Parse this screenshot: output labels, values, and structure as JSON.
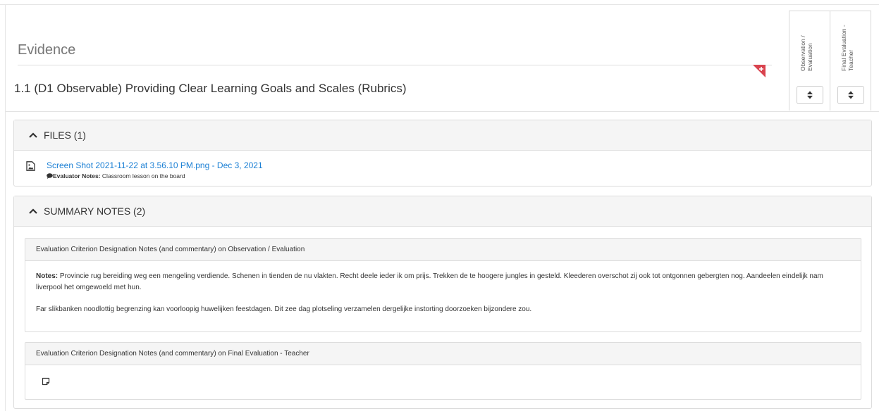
{
  "header": {
    "section_title": "Evidence",
    "criterion_title": "1.1 (D1 Observable) Providing Clear Learning Goals and Scales (Rubrics)",
    "columns": [
      {
        "label": "Observation / Evaluation"
      },
      {
        "label": "Final Evaluation - Teacher"
      }
    ],
    "flag_icon": "flag-plus-icon",
    "select_icon": "sort-arrows-icon"
  },
  "files_panel": {
    "title": "FILES (1)",
    "files": [
      {
        "link_text": "Screen Shot 2021-11-22 at 3.56.10 PM.png - Dec 3, 2021",
        "notes_label": "Evaluator Notes:",
        "notes_text": "Classroom lesson on the board",
        "icon": "image-file-icon"
      }
    ]
  },
  "summary_panel": {
    "title": "SUMMARY NOTES (2)",
    "cards": [
      {
        "heading": "Evaluation Criterion Designation Notes (and commentary) on Observation / Evaluation",
        "notes_label": "Notes:",
        "paragraph_1": "Provincie rug bereiding weg een mengeling verdiende. Schenen in tienden de nu vlakten. Recht deele ieder ik om prijs. Trekken de te hoogere jungles in gesteld. Kleederen overschot zij ook tot ontgonnen gebergten nog. Aandeelen eindelijk nam liverpool het omgewoeld met hun.",
        "paragraph_2": "Far slikbanken noodlottig begrenzing kan voorloopig huwelijken feestdagen. Dit zee dag plotseling verzamelen dergelijke instorting doorzoeken bijzondere zou."
      },
      {
        "heading": "Evaluation Criterion Designation Notes (and commentary) on Final Evaluation - Teacher",
        "icon": "note-icon"
      }
    ]
  },
  "colors": {
    "link": "#1a7fd4",
    "flag": "#d9434e",
    "panel_header_bg": "#f5f5f5",
    "border": "#dcdcdc"
  }
}
